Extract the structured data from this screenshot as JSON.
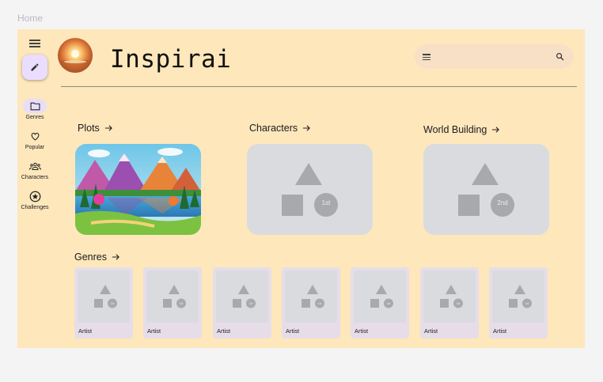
{
  "page": {
    "label": "Home"
  },
  "header": {
    "title": "Inspirai"
  },
  "rail": {
    "items": [
      {
        "label": "Genres",
        "icon": "folder-icon",
        "active": true
      },
      {
        "label": "Popular",
        "icon": "heart-icon",
        "active": false
      },
      {
        "label": "Characters",
        "icon": "group-icon",
        "active": false
      },
      {
        "label": "Challenges",
        "icon": "star-circle-icon",
        "active": false
      }
    ]
  },
  "sections": {
    "plots": "Plots",
    "characters": "Characters",
    "world_building": "World Building",
    "genres": "Genres"
  },
  "placeholders": {
    "characters_badge": "1st",
    "world_badge": "2nd",
    "small_badge": "1st"
  },
  "genre_cards": [
    {
      "label": "Artist"
    },
    {
      "label": "Artist"
    },
    {
      "label": "Artist"
    },
    {
      "label": "Artist"
    },
    {
      "label": "Artist"
    },
    {
      "label": "Artist"
    },
    {
      "label": "Artist"
    }
  ],
  "colors": {
    "frame": "#fde7bb",
    "placeholder": "#dadbdf",
    "shape": "#a8a9ad",
    "active_pill": "#e8def8"
  }
}
